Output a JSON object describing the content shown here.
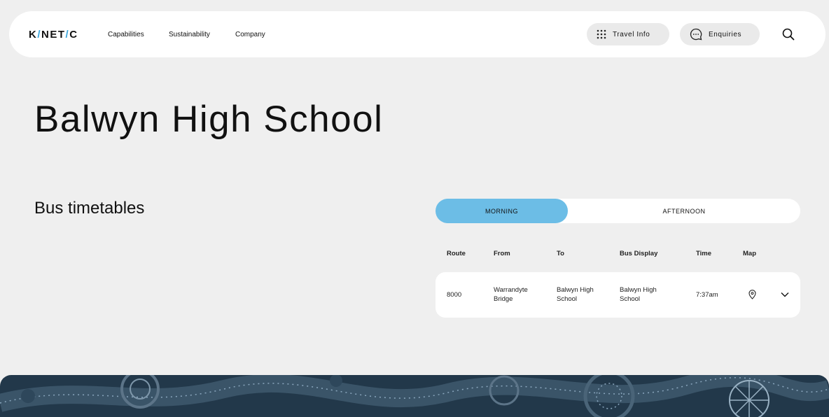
{
  "nav": {
    "logo": {
      "part1": "K",
      "slash1": "/",
      "part2": "NET",
      "slash2": "/",
      "part3": "C"
    },
    "links": [
      "Capabilities",
      "Sustainability",
      "Company"
    ],
    "travel_info": {
      "label": "Travel Info",
      "icon": "grid-icon"
    },
    "enquiries": {
      "label": "Enquiries",
      "icon": "chat-icon"
    },
    "search_icon": "search-icon"
  },
  "page": {
    "title": "Balwyn High School",
    "section_title": "Bus timetables"
  },
  "timetable": {
    "tabs": [
      {
        "label": "MORNING",
        "active": true
      },
      {
        "label": "AFTERNOON",
        "active": false
      }
    ],
    "columns": [
      "Route",
      "From",
      "To",
      "Bus Display",
      "Time",
      "Map"
    ],
    "rows": [
      {
        "route": "8000",
        "from_line1": "Warrandyte",
        "from_line2": "Bridge",
        "to_line1": "Balwyn High",
        "to_line2": "School",
        "display_line1": "Balwyn High",
        "display_line2": "School",
        "time": "7:37am",
        "map_icon": "map-pin-icon",
        "expand_icon": "chevron-down-icon"
      }
    ]
  },
  "colors": {
    "accent": "#6cbde6",
    "logo_slash": "#3aa6dd",
    "background": "#efefef",
    "footer": "#22384a"
  }
}
